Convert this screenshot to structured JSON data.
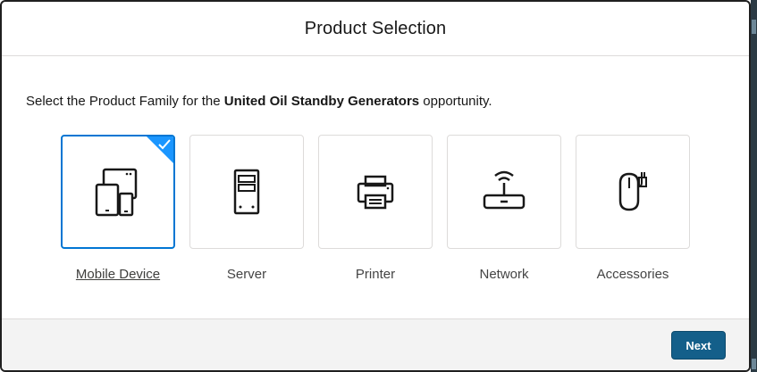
{
  "modal": {
    "title": "Product Selection",
    "prompt_prefix": "Select the Product Family for the ",
    "opportunity_name": "United Oil Standby Generators",
    "prompt_suffix": " opportunity."
  },
  "products": [
    {
      "label": "Mobile Device",
      "icon": "mobile-devices-icon",
      "selected": true
    },
    {
      "label": "Server",
      "icon": "server-tower-icon",
      "selected": false
    },
    {
      "label": "Printer",
      "icon": "printer-icon",
      "selected": false
    },
    {
      "label": "Network",
      "icon": "router-icon",
      "selected": false
    },
    {
      "label": "Accessories",
      "icon": "mouse-icon",
      "selected": false
    }
  ],
  "footer": {
    "next_label": "Next"
  },
  "colors": {
    "selected_border": "#0176d3",
    "check_corner": "#1b96ff",
    "next_button": "#145f8a"
  }
}
